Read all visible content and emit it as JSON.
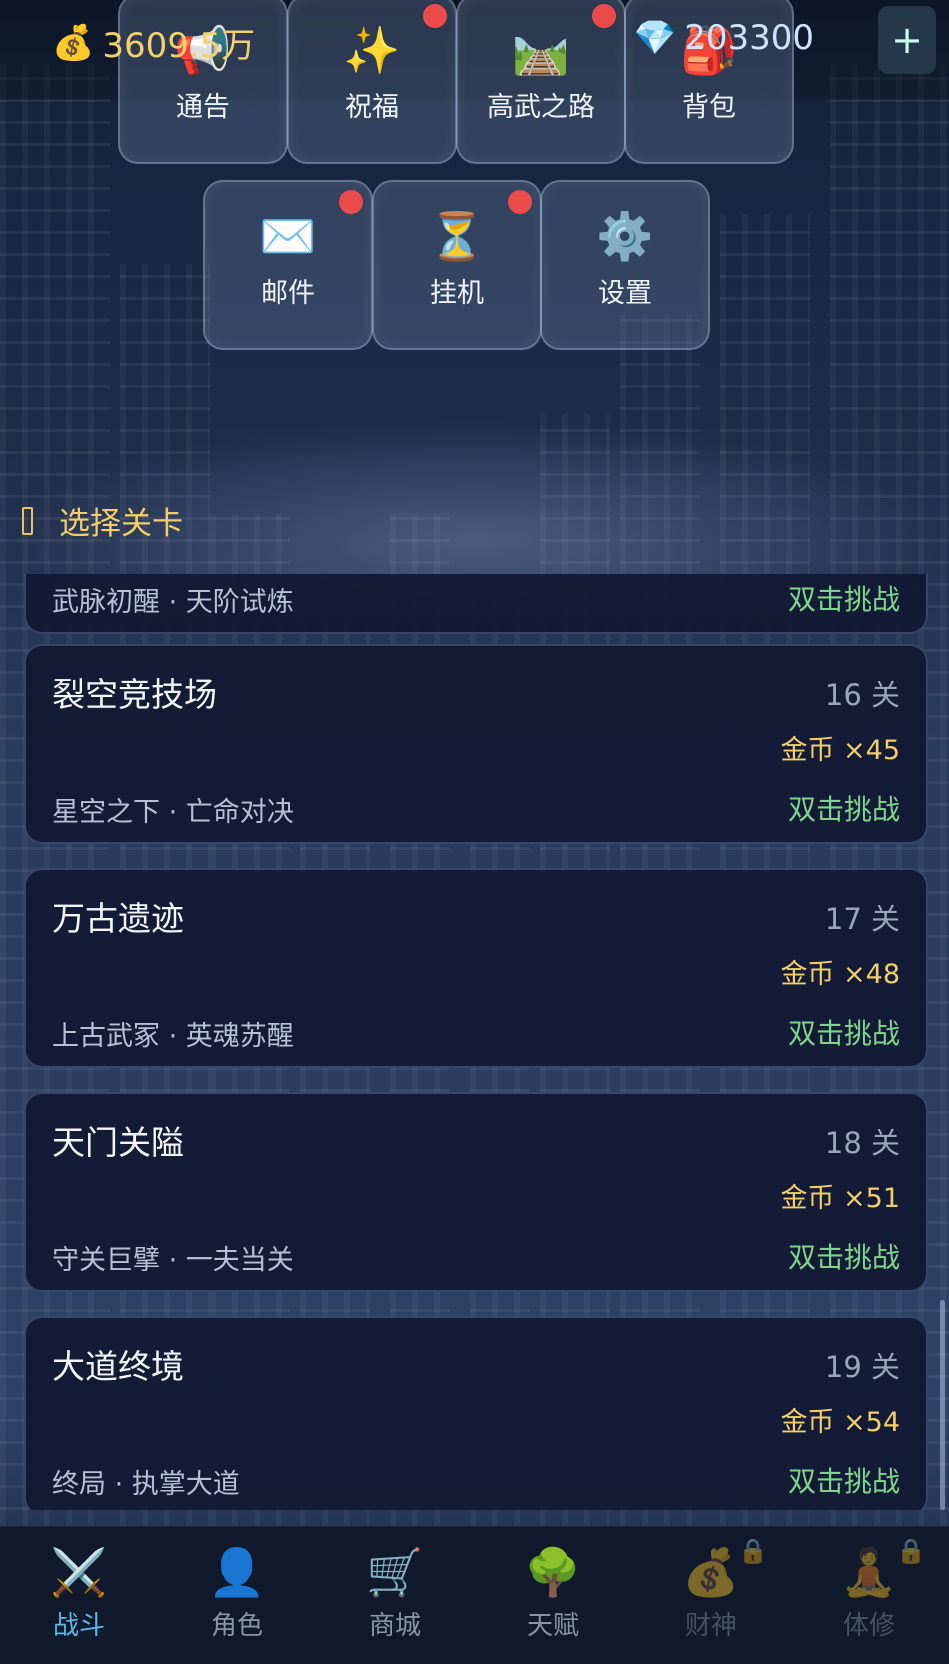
{
  "currency": {
    "gold": "3609.5万",
    "gems": "203300",
    "add_label": "+"
  },
  "menu": [
    {
      "label": "通告",
      "icon": "megaphone-icon",
      "glyph": "📢",
      "badge": false
    },
    {
      "label": "祝福",
      "icon": "sparkles-icon",
      "glyph": "✨",
      "badge": true
    },
    {
      "label": "高武之路",
      "icon": "road-icon",
      "glyph": "🛤️",
      "badge": true
    },
    {
      "label": "背包",
      "icon": "backpack-icon",
      "glyph": "🎒",
      "badge": false
    },
    {
      "label": "邮件",
      "icon": "mail-icon",
      "glyph": "✉️",
      "badge": true
    },
    {
      "label": "挂机",
      "icon": "hourglass-icon",
      "glyph": "⏳",
      "badge": true
    },
    {
      "label": "设置",
      "icon": "gear-icon",
      "glyph": "⚙️",
      "badge": false
    }
  ],
  "section_title": "选择关卡",
  "levels": [
    {
      "name": "",
      "number": "",
      "reward": "",
      "subtitle": "武脉初醒 · 天阶试炼",
      "action": "双击挑战"
    },
    {
      "name": "裂空竞技场",
      "number": "16 关",
      "reward": "金币 ×45",
      "subtitle": "星空之下 · 亡命对决",
      "action": "双击挑战"
    },
    {
      "name": "万古遗迹",
      "number": "17 关",
      "reward": "金币 ×48",
      "subtitle": "上古武冢 · 英魂苏醒",
      "action": "双击挑战"
    },
    {
      "name": "天门关隘",
      "number": "18 关",
      "reward": "金币 ×51",
      "subtitle": "守关巨擘 · 一夫当关",
      "action": "双击挑战"
    },
    {
      "name": "大道终境",
      "number": "19 关",
      "reward": "金币 ×54",
      "subtitle": "终局 · 执掌大道",
      "action": "双击挑战"
    }
  ],
  "nav": [
    {
      "label": "战斗",
      "icon": "crossed-swords-icon",
      "glyph": "⚔️",
      "active": true,
      "locked": false
    },
    {
      "label": "角色",
      "icon": "person-icon",
      "glyph": "👤",
      "active": false,
      "locked": false
    },
    {
      "label": "商城",
      "icon": "shopping-cart-icon",
      "glyph": "🛒",
      "active": false,
      "locked": false
    },
    {
      "label": "天赋",
      "icon": "tree-icon",
      "glyph": "🌳",
      "active": false,
      "locked": false
    },
    {
      "label": "财神",
      "icon": "money-bag-icon",
      "glyph": "💰",
      "active": false,
      "locked": true
    },
    {
      "label": "体修",
      "icon": "meditation-icon",
      "glyph": "🧘",
      "active": false,
      "locked": true
    }
  ],
  "colors": {
    "accent_gold": "#f2cd68",
    "action_green": "#7ed58a",
    "active_tab": "#58b8e8",
    "badge_red": "#ec4b4b"
  }
}
